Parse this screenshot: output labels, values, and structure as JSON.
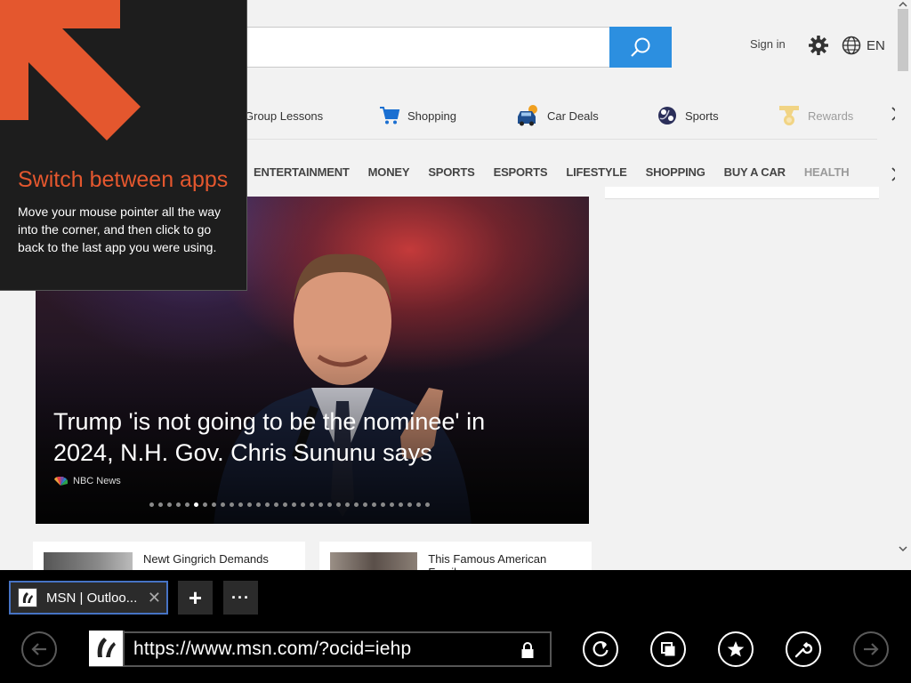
{
  "header": {
    "search_placeholder": "",
    "sign_in": "Sign in",
    "language": "EN"
  },
  "quick_links": [
    {
      "label": "Group Lessons",
      "icon": "group-lessons-icon"
    },
    {
      "label": "Shopping",
      "icon": "shopping-cart-icon"
    },
    {
      "label": "Car Deals",
      "icon": "car-deals-icon"
    },
    {
      "label": "Sports",
      "icon": "sports-ball-icon"
    },
    {
      "label": "Rewards",
      "icon": "rewards-medal-icon"
    }
  ],
  "categories": [
    "ENTERTAINMENT",
    "MONEY",
    "SPORTS",
    "ESPORTS",
    "LIFESTYLE",
    "SHOPPING",
    "BUY A CAR",
    "HEALTH"
  ],
  "hero": {
    "title": "Trump 'is not going to be the nominee' in 2024, N.H. Gov. Chris Sununu says",
    "source": "NBC News",
    "slide_count": 32,
    "active_slide": 5
  },
  "news": [
    {
      "title": "Newt Gingrich Demands"
    },
    {
      "title": "This Famous American Family"
    }
  ],
  "tip": {
    "title": "Switch between apps",
    "body": "Move your mouse pointer all the way into the corner, and then click to go back to the last app you were using."
  },
  "browser": {
    "tab_title": "MSN | Outloo...",
    "new_tab_label": "+",
    "more_label": "···",
    "url": "https://www.msn.com/?ocid=iehp"
  },
  "colors": {
    "accent_orange": "#e4572e",
    "search_blue": "#2c8fe0",
    "tab_border": "#4673c4"
  }
}
